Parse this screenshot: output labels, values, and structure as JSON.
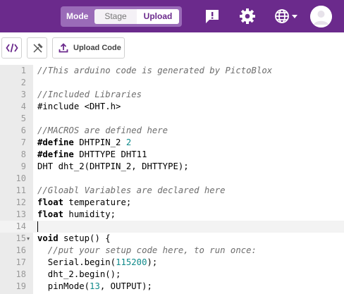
{
  "header": {
    "mode_label": "Mode",
    "stage_label": "Stage",
    "upload_label": "Upload",
    "colors": {
      "bar": "#6b2a8c",
      "accent": "#9a6bb8"
    },
    "icons": [
      "feedback-icon",
      "settings-gear-icon",
      "language-globe-icon",
      "user-avatar-icon"
    ]
  },
  "toolbar": {
    "upload_code_label": "Upload Code",
    "icons": [
      "code-view-icon",
      "tools-icon",
      "upload-icon"
    ]
  },
  "editor": {
    "lines": [
      {
        "num": "1",
        "fold": "",
        "tokens": [
          {
            "t": "comment",
            "v": "//This arduino code is generated by PictoBlox"
          }
        ]
      },
      {
        "num": "2",
        "fold": "",
        "tokens": []
      },
      {
        "num": "3",
        "fold": "",
        "tokens": [
          {
            "t": "comment",
            "v": "//Included Libraries"
          }
        ]
      },
      {
        "num": "4",
        "fold": "",
        "tokens": [
          {
            "t": "plain",
            "v": "#include <DHT.h>"
          }
        ]
      },
      {
        "num": "5",
        "fold": "",
        "tokens": []
      },
      {
        "num": "6",
        "fold": "",
        "tokens": [
          {
            "t": "comment",
            "v": "//MACROS are defined here"
          }
        ]
      },
      {
        "num": "7",
        "fold": "",
        "tokens": [
          {
            "t": "keyword",
            "v": "#define"
          },
          {
            "t": "plain",
            "v": " DHTPIN_2 "
          },
          {
            "t": "number",
            "v": "2"
          }
        ]
      },
      {
        "num": "8",
        "fold": "",
        "tokens": [
          {
            "t": "keyword",
            "v": "#define"
          },
          {
            "t": "plain",
            "v": " DHTTYPE DHT11"
          }
        ]
      },
      {
        "num": "9",
        "fold": "",
        "tokens": [
          {
            "t": "plain",
            "v": "DHT dht_2(DHTPIN_2, DHTTYPE);"
          }
        ]
      },
      {
        "num": "10",
        "fold": "",
        "tokens": []
      },
      {
        "num": "11",
        "fold": "",
        "tokens": [
          {
            "t": "comment",
            "v": "//Gloabl Variables are declared here"
          }
        ]
      },
      {
        "num": "12",
        "fold": "",
        "tokens": [
          {
            "t": "keyword",
            "v": "float"
          },
          {
            "t": "plain",
            "v": " temperature;"
          }
        ]
      },
      {
        "num": "13",
        "fold": "",
        "tokens": [
          {
            "t": "keyword",
            "v": "float"
          },
          {
            "t": "plain",
            "v": " humidity;"
          }
        ]
      },
      {
        "num": "14",
        "fold": "",
        "tokens": [],
        "active": true
      },
      {
        "num": "15",
        "fold": "▾",
        "tokens": [
          {
            "t": "keyword",
            "v": "void"
          },
          {
            "t": "plain",
            "v": " setup() {"
          }
        ]
      },
      {
        "num": "16",
        "fold": "",
        "tokens": [
          {
            "t": "comment",
            "v": "  //put your setup code here, to run once:"
          }
        ]
      },
      {
        "num": "17",
        "fold": "",
        "tokens": [
          {
            "t": "plain",
            "v": "  Serial.begin("
          },
          {
            "t": "number",
            "v": "115200"
          },
          {
            "t": "plain",
            "v": ");"
          }
        ]
      },
      {
        "num": "18",
        "fold": "",
        "tokens": [
          {
            "t": "plain",
            "v": "  dht_2.begin();"
          }
        ]
      },
      {
        "num": "19",
        "fold": "",
        "tokens": [
          {
            "t": "plain",
            "v": "  pinMode("
          },
          {
            "t": "number",
            "v": "13"
          },
          {
            "t": "plain",
            "v": ", OUTPUT);"
          }
        ]
      }
    ]
  }
}
